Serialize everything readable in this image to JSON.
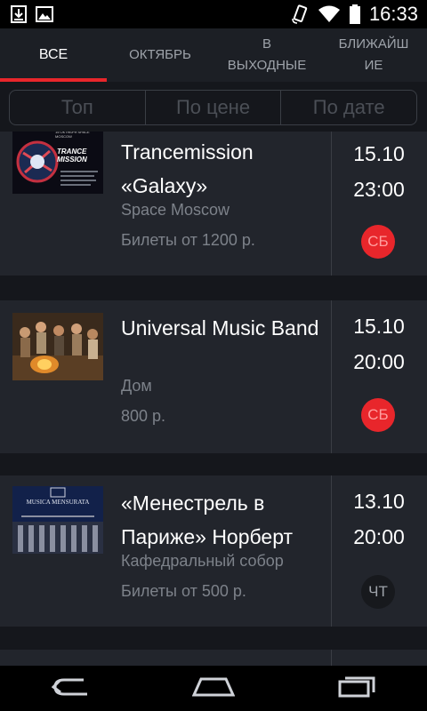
{
  "status_bar": {
    "time": "16:33",
    "icons": [
      "download-icon",
      "image-icon",
      "rotate-icon",
      "wifi-icon",
      "battery-icon"
    ]
  },
  "tabs": [
    {
      "label": "ВСЕ",
      "active": true
    },
    {
      "label": "ОКТЯБРЬ",
      "active": false
    },
    {
      "label": "В\nВЫХОДНЫЕ",
      "active": false
    },
    {
      "label": "БЛИЖАЙШ\nИЕ",
      "active": false
    }
  ],
  "sort": {
    "options": [
      "Топ",
      "По цене",
      "По дате"
    ]
  },
  "events": [
    {
      "title": "Trancemission «Galaxy»",
      "venue": "Space Moscow",
      "price": "Билеты от 1200 р.",
      "date": "15.10",
      "time": "23:00",
      "day": "СБ",
      "day_style": "red",
      "poster_text": "TRANCE MISSION",
      "poster_caption": "15 ОКТЯБРЯ SPACE MOSCOW"
    },
    {
      "title": "Universal Music Band",
      "venue": "Дом",
      "price": "800 р.",
      "date": "15.10",
      "time": "20:00",
      "day": "СБ",
      "day_style": "red"
    },
    {
      "title": "«Менестрель в Париже» Норберт",
      "venue": "Кафедральный собор",
      "price": "Билеты от 500 р.",
      "date": "13.10",
      "time": "20:00",
      "day": "ЧТ",
      "day_style": "dark",
      "poster_text": "MUSICA MENSURATA"
    }
  ],
  "colors": {
    "accent": "#e8262b",
    "background": "#15171c",
    "card": "#22252c",
    "muted_text": "#7d828a"
  },
  "nav": [
    "back-icon",
    "home-icon",
    "recent-apps-icon"
  ]
}
